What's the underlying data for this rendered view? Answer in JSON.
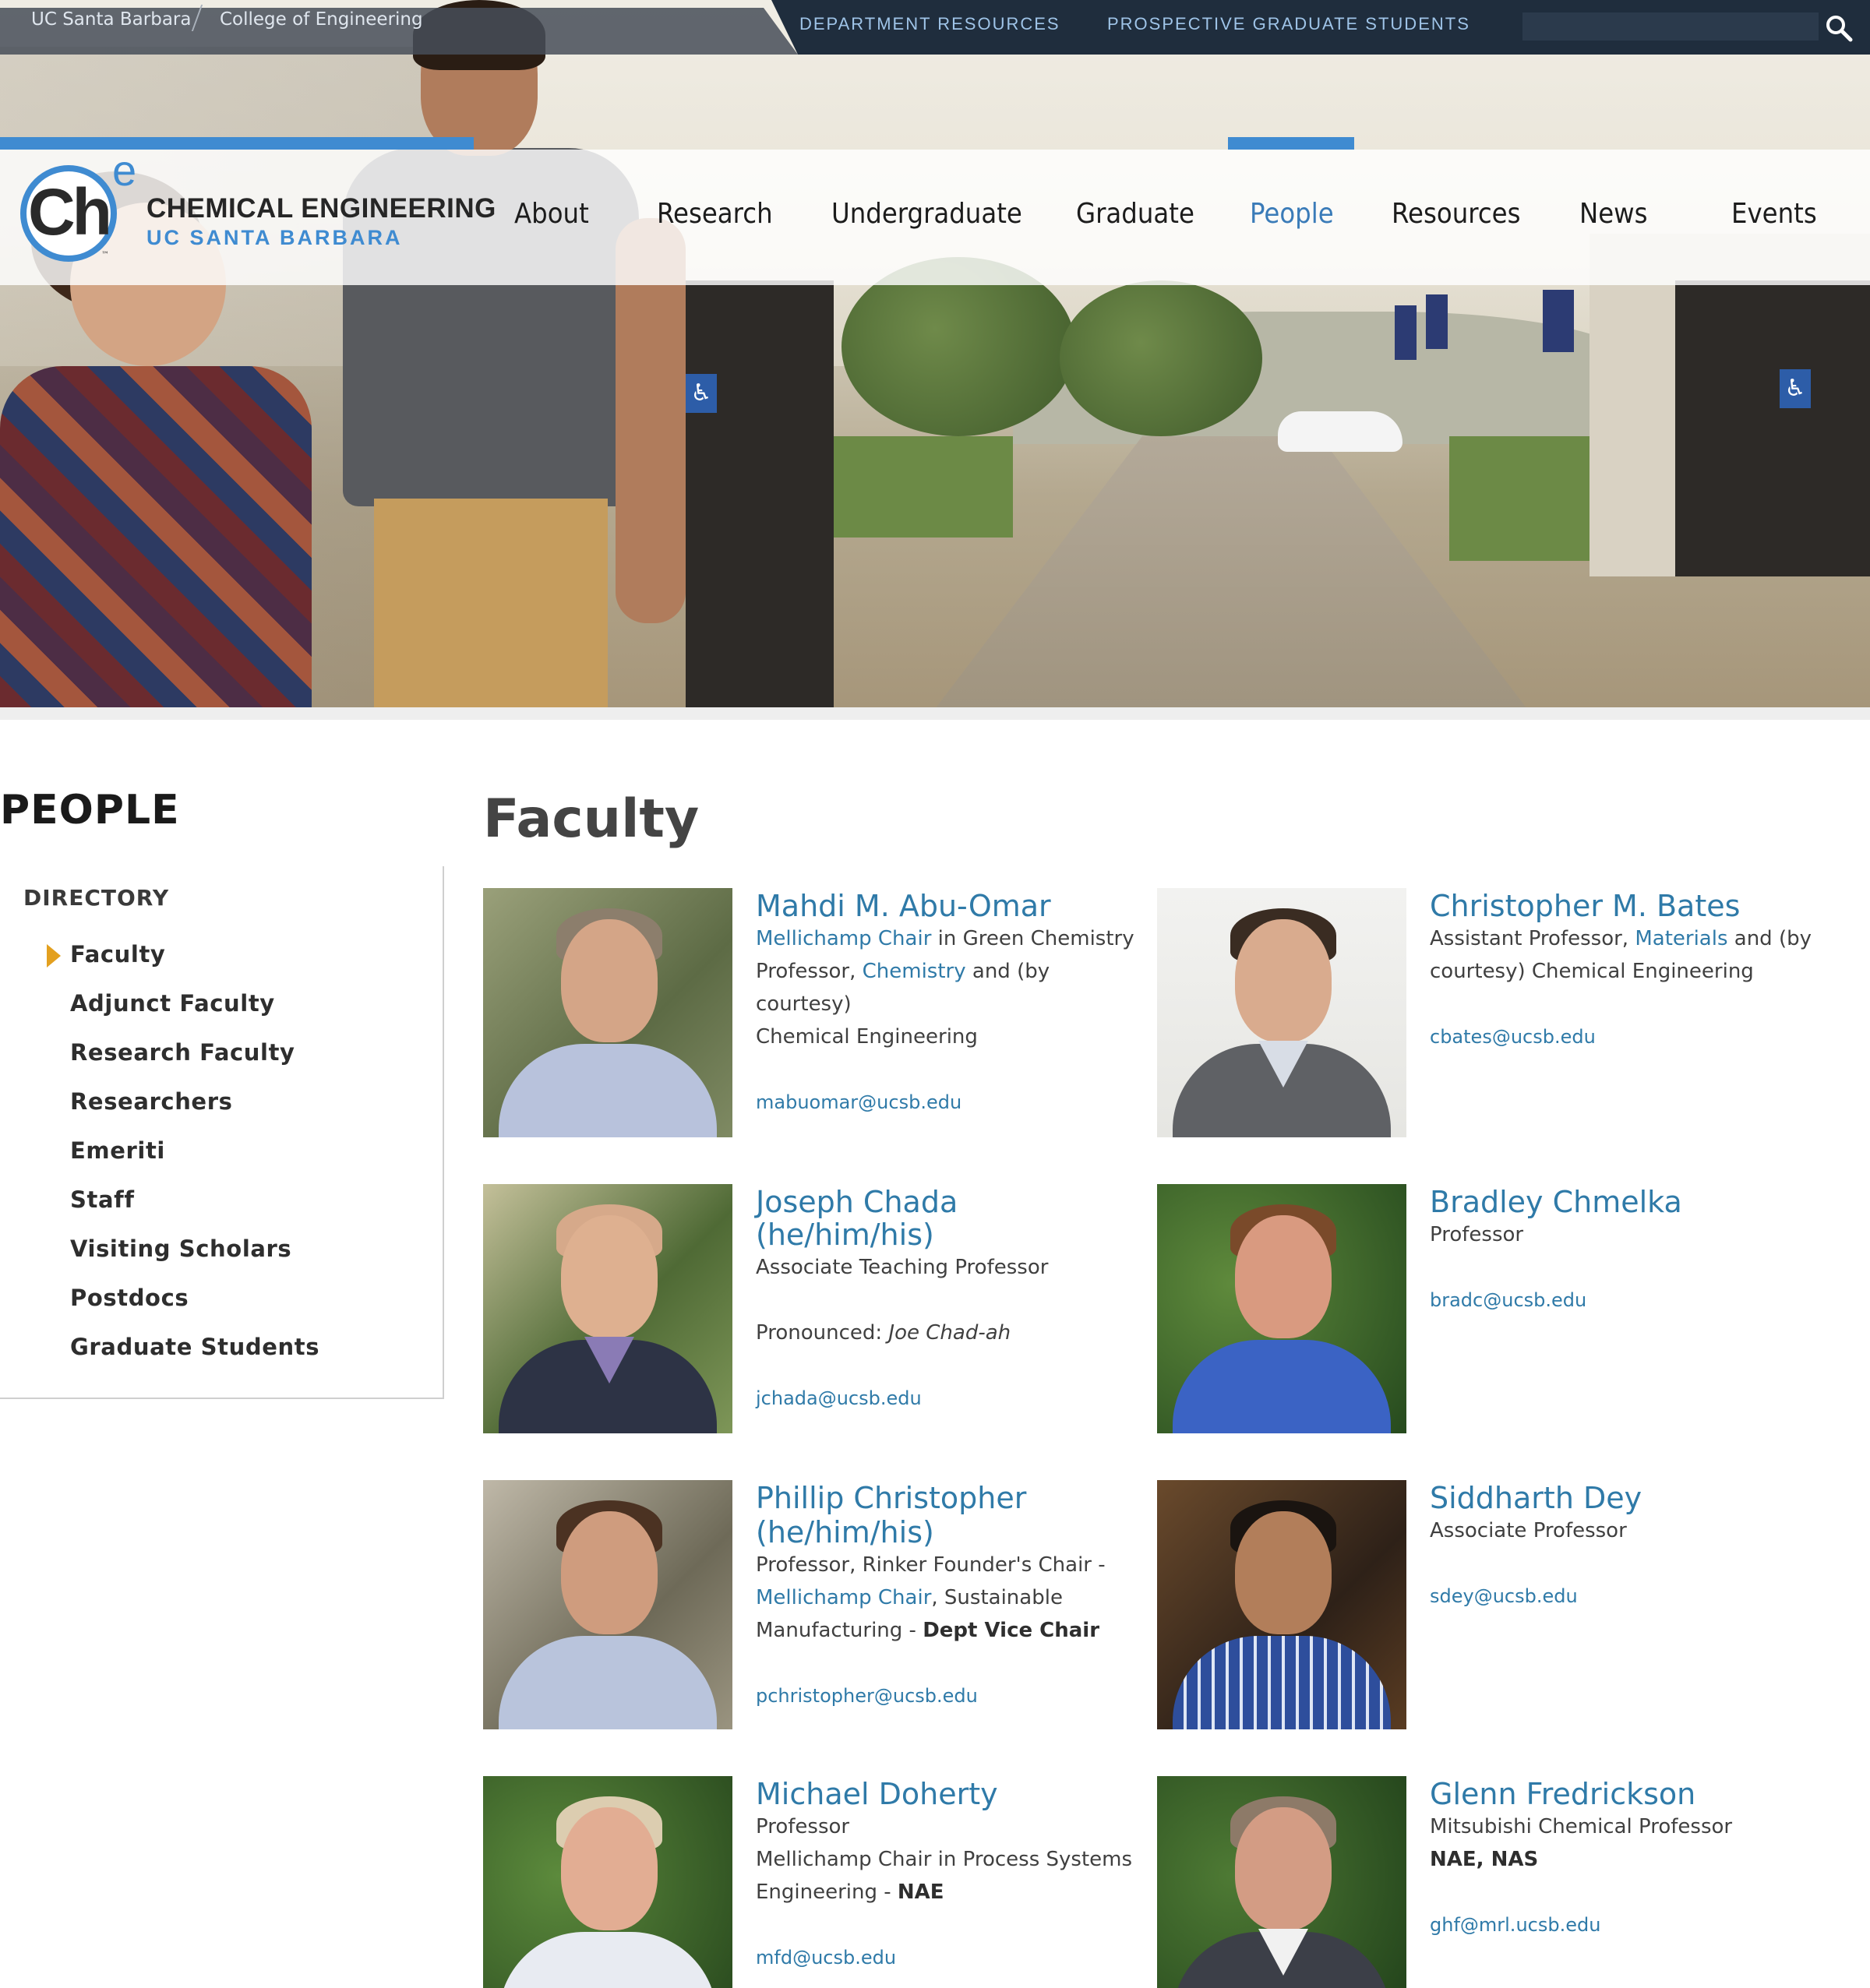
{
  "topbar": {
    "crumb_university": "UC Santa Barbara",
    "crumb_college": "College of Engineering",
    "link_department_resources": "DEPARTMENT RESOURCES",
    "link_prospective": "PROSPECTIVE GRADUATE STUDENTS",
    "search_value": ""
  },
  "logo": {
    "ch": "Ch",
    "e": "e",
    "tm": "™",
    "title": "CHEMICAL ENGINEERING",
    "subtitle": "UC SANTA BARBARA"
  },
  "nav": {
    "items": [
      "About",
      "Research",
      "Undergraduate",
      "Graduate",
      "People",
      "Resources",
      "News",
      "Events"
    ],
    "active": "People"
  },
  "sidebar": {
    "title": "PEOPLE",
    "heading": "DIRECTORY",
    "items": [
      "Faculty",
      "Adjunct Faculty",
      "Research Faculty",
      "Researchers",
      "Emeriti",
      "Staff",
      "Visiting Scholars",
      "Postdocs",
      "Graduate Students"
    ],
    "active": "Faculty"
  },
  "main": {
    "title": "Faculty",
    "people": [
      {
        "name": "Mahdi M. Abu-Omar",
        "l1_link": "Mellichamp Chair",
        "l1_rest": " in Green Chemistry",
        "l2_pre": "Professor, ",
        "l2_link": "Chemistry",
        "l2_rest": " and (by courtesy)",
        "l3": "Chemical Engineering",
        "email": "mabuomar@ucsb.edu"
      },
      {
        "name": "Christopher M. Bates",
        "l1_pre": "Assistant Professor, ",
        "l1_link": "Materials",
        "l1_rest": " and (by",
        "l2": "courtesy) Chemical Engineering",
        "email": "cbates@ucsb.edu"
      },
      {
        "name": "Joseph Chada (he/him/his)",
        "l1": "Associate Teaching Professor",
        "pron_label": "Pronounced: ",
        "pron_value": "Joe Chad-ah",
        "email": "jchada@ucsb.edu"
      },
      {
        "name": "Bradley Chmelka",
        "l1": "Professor",
        "email": "bradc@ucsb.edu"
      },
      {
        "name_l1": "Phillip Christopher",
        "name_l2": "(he/him/his)",
        "l1": "Professor, Rinker Founder's Chair -",
        "l2_link": "Mellichamp Chair",
        "l2_rest": ", Sustainable",
        "l3_pre": "Manufacturing - ",
        "l3_bold": "Dept Vice Chair",
        "email": "pchristopher@ucsb.edu"
      },
      {
        "name": "Siddharth Dey",
        "l1": "Associate Professor",
        "email": "sdey@ucsb.edu"
      },
      {
        "name": "Michael Doherty",
        "l1": "Professor",
        "l2": "Mellichamp Chair in Process Systems",
        "l3_pre": "Engineering - ",
        "l3_bold": "NAE",
        "email": "mfd@ucsb.edu"
      },
      {
        "name": "Glenn Fredrickson",
        "l1": "Mitsubishi Chemical Professor",
        "l2_bold": "NAE, NAS",
        "email": "ghf@mrl.ucsb.edu"
      }
    ]
  },
  "colors": {
    "accent_blue": "#3f8bd1",
    "link_blue": "#2f7aa8",
    "topbar_dark": "#1f2d3d",
    "marker_gold": "#e3a01f"
  },
  "icons": {
    "search": "search-icon",
    "marker": "triangle-right-icon"
  }
}
